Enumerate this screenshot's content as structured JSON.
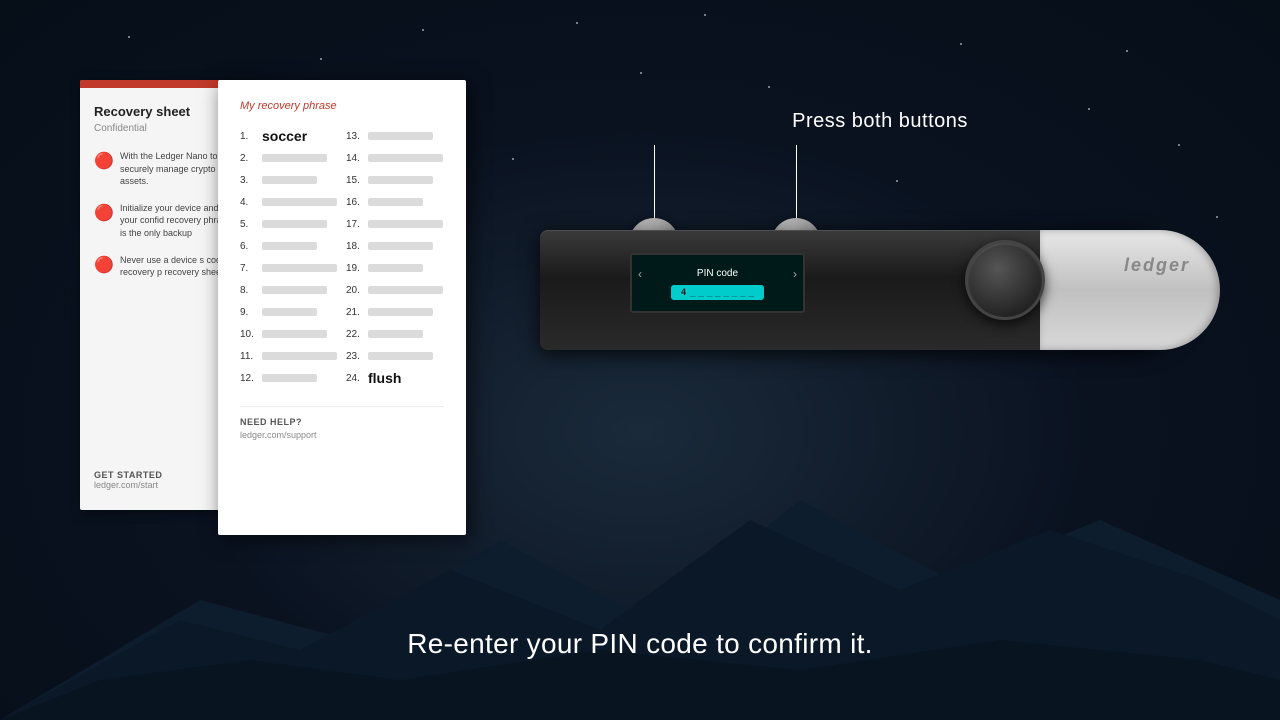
{
  "background": {
    "color": "#0a1628"
  },
  "recoverySheetBg": {
    "title": "Recovery sheet",
    "subtitle": "Confidential",
    "redBarColor": "#c0392b",
    "paragraphs": [
      "With the Ledger Nano S, private keys to securely manage crypto assets.",
      "Initialize your device to and save your confidential recovery phrase. Your is the only backup of y...",
      "Never use a device sup... code or a recovery ph... recovery sheet(s) in a s..."
    ],
    "getStarted": "GET STARTED",
    "url": "ledger.com/start"
  },
  "phraseCard": {
    "title": "My recovery phrase",
    "titleColor": "#c0392b",
    "words": [
      {
        "num": "1.",
        "word": "soccer",
        "visible": true
      },
      {
        "num": "2.",
        "word": "",
        "visible": false
      },
      {
        "num": "3.",
        "word": "",
        "visible": false
      },
      {
        "num": "4.",
        "word": "",
        "visible": false
      },
      {
        "num": "5.",
        "word": "",
        "visible": false
      },
      {
        "num": "6.",
        "word": "",
        "visible": false
      },
      {
        "num": "7.",
        "word": "",
        "visible": false
      },
      {
        "num": "8.",
        "word": "",
        "visible": false
      },
      {
        "num": "9.",
        "word": "",
        "visible": false
      },
      {
        "num": "10.",
        "word": "",
        "visible": false
      },
      {
        "num": "11.",
        "word": "",
        "visible": false
      },
      {
        "num": "12.",
        "word": "",
        "visible": false
      },
      {
        "num": "13.",
        "word": "",
        "visible": false
      },
      {
        "num": "14.",
        "word": "",
        "visible": false
      },
      {
        "num": "15.",
        "word": "",
        "visible": false
      },
      {
        "num": "16.",
        "word": "",
        "visible": false
      },
      {
        "num": "17.",
        "word": "",
        "visible": false
      },
      {
        "num": "18.",
        "word": "",
        "visible": false
      },
      {
        "num": "19.",
        "word": "",
        "visible": false
      },
      {
        "num": "20.",
        "word": "",
        "visible": false
      },
      {
        "num": "21.",
        "word": "",
        "visible": false
      },
      {
        "num": "22.",
        "word": "",
        "visible": false
      },
      {
        "num": "23.",
        "word": "",
        "visible": false
      },
      {
        "num": "24.",
        "word": "flush",
        "visible": true
      }
    ],
    "needHelp": "NEED HELP?",
    "supportUrl": "ledger.com/support"
  },
  "device": {
    "pressBothButtons": "Press both buttons",
    "screen": {
      "title": "PIN code",
      "pinDisplay": "4 _ _ _ _ _ _ _ _"
    }
  },
  "subtitle": "Re-enter your PIN code to confirm it."
}
